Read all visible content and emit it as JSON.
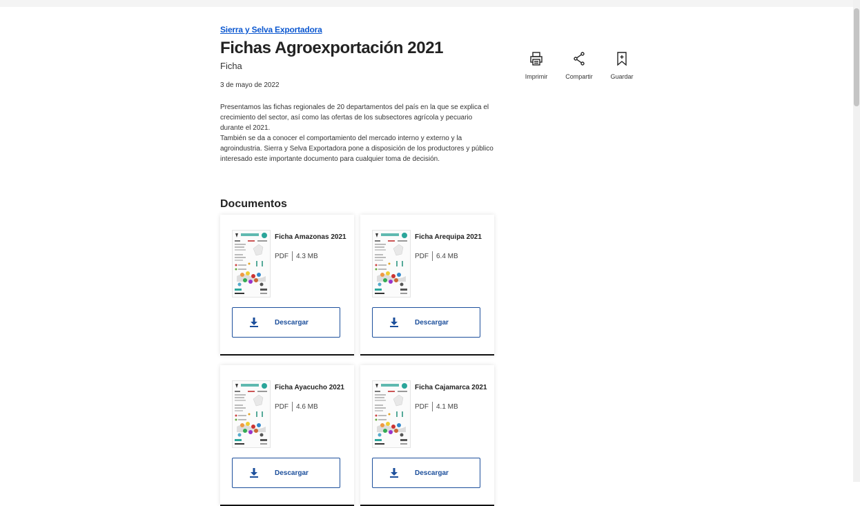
{
  "breadcrumb": "Sierra y Selva Exportadora",
  "title": "Fichas Agroexportación 2021",
  "type": "Ficha",
  "date": "3 de mayo de 2022",
  "description": [
    "Presentamos las fichas regionales de 20 departamentos del país en la que se explica el crecimiento del sector, así como las ofertas de los subsectores agrícola y pecuario durante el 2021.",
    "También se da a conocer el comportamiento del mercado interno y externo y la agroindustria. Sierra y Selva Exportadora pone a disposición de los productores y público interesado este importante documento para cualquier toma de decisión."
  ],
  "actions": {
    "print": "Imprimir",
    "share": "Compartir",
    "save": "Guardar"
  },
  "documents_heading": "Documentos",
  "documents": [
    {
      "title": "Ficha Amazonas 2021",
      "format": "PDF",
      "size": "4.3 MB",
      "button": "Descargar"
    },
    {
      "title": "Ficha Arequipa 2021",
      "format": "PDF",
      "size": "6.4 MB",
      "button": "Descargar"
    },
    {
      "title": "Ficha Ayacucho 2021",
      "format": "PDF",
      "size": "4.6 MB",
      "button": "Descargar"
    },
    {
      "title": "Ficha Cajamarca 2021",
      "format": "PDF",
      "size": "4.1 MB",
      "button": "Descargar"
    }
  ],
  "colors": {
    "link": "#0b57d0",
    "button_border": "#1b4e9b"
  }
}
